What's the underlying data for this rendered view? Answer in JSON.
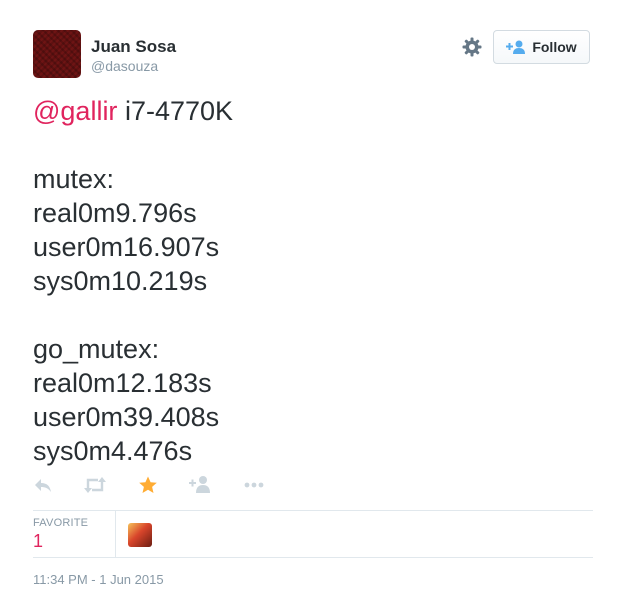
{
  "user": {
    "display_name": "Juan Sosa",
    "handle": "@dasouza"
  },
  "header": {
    "follow_label": "Follow"
  },
  "tweet": {
    "mention": "@gallir",
    "text_after_mention": " i7-4770K\n\nmutex:\nreal0m9.796s\nuser0m16.907s\nsys0m10.219s\n\ngo_mutex:\nreal0m12.183s\nuser0m39.408s\nsys0m4.476s"
  },
  "actions": [
    "reply-icon",
    "retweet-icon",
    "favorite-icon",
    "follow-icon",
    "more-icon"
  ],
  "stats": {
    "favorite_label": "FAVORITE",
    "favorite_count": "1"
  },
  "timestamp": "11:34 PM - 1 Jun 2015",
  "colors": {
    "mention": "#e0245e",
    "favorite_star": "#ffac33",
    "secondary_text": "#8899a6",
    "follow_icon": "#55acee"
  }
}
